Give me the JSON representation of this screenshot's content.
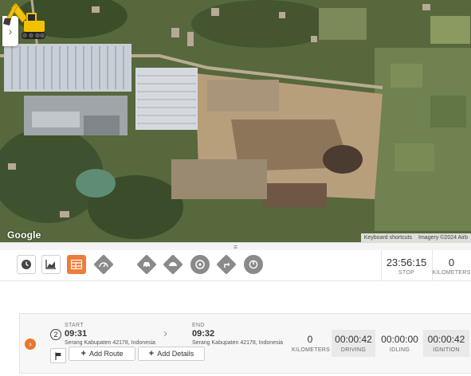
{
  "map": {
    "logo": "Google",
    "keyboard_shortcuts": "Keyboard shortcuts",
    "imagery": "Imagery ©2024 Airb"
  },
  "toolbar": {
    "icons": [
      "clock-icon",
      "chart-icon",
      "grid-icon",
      "gauge-icon",
      "car-icon",
      "brake-icon",
      "steering-icon",
      "route-turn-icon",
      "ignition-icon"
    ],
    "stop_time": "23:56:15",
    "stop_label": "STOP",
    "kilometers_value": "0",
    "kilometers_label": "KILOMETERS"
  },
  "trip": {
    "number": "2",
    "start_label": "START",
    "start_time": "09:31",
    "start_address": "Serang Kabupaten 42178, Indonesia",
    "end_label": "END",
    "end_time": "09:32",
    "end_address": "Serang Kabupaten 42178, Indonesia",
    "add_route_label": "Add Route",
    "add_details_label": "Add Details",
    "kilometers_value": "0",
    "kilometers_label": "KILOMETERS",
    "driving_value": "00:00:42",
    "driving_label": "DRIVING",
    "idling_value": "00:00:00",
    "idling_label": "IDLING",
    "ignition_value": "00:00:42",
    "ignition_label": "IGNITION"
  }
}
